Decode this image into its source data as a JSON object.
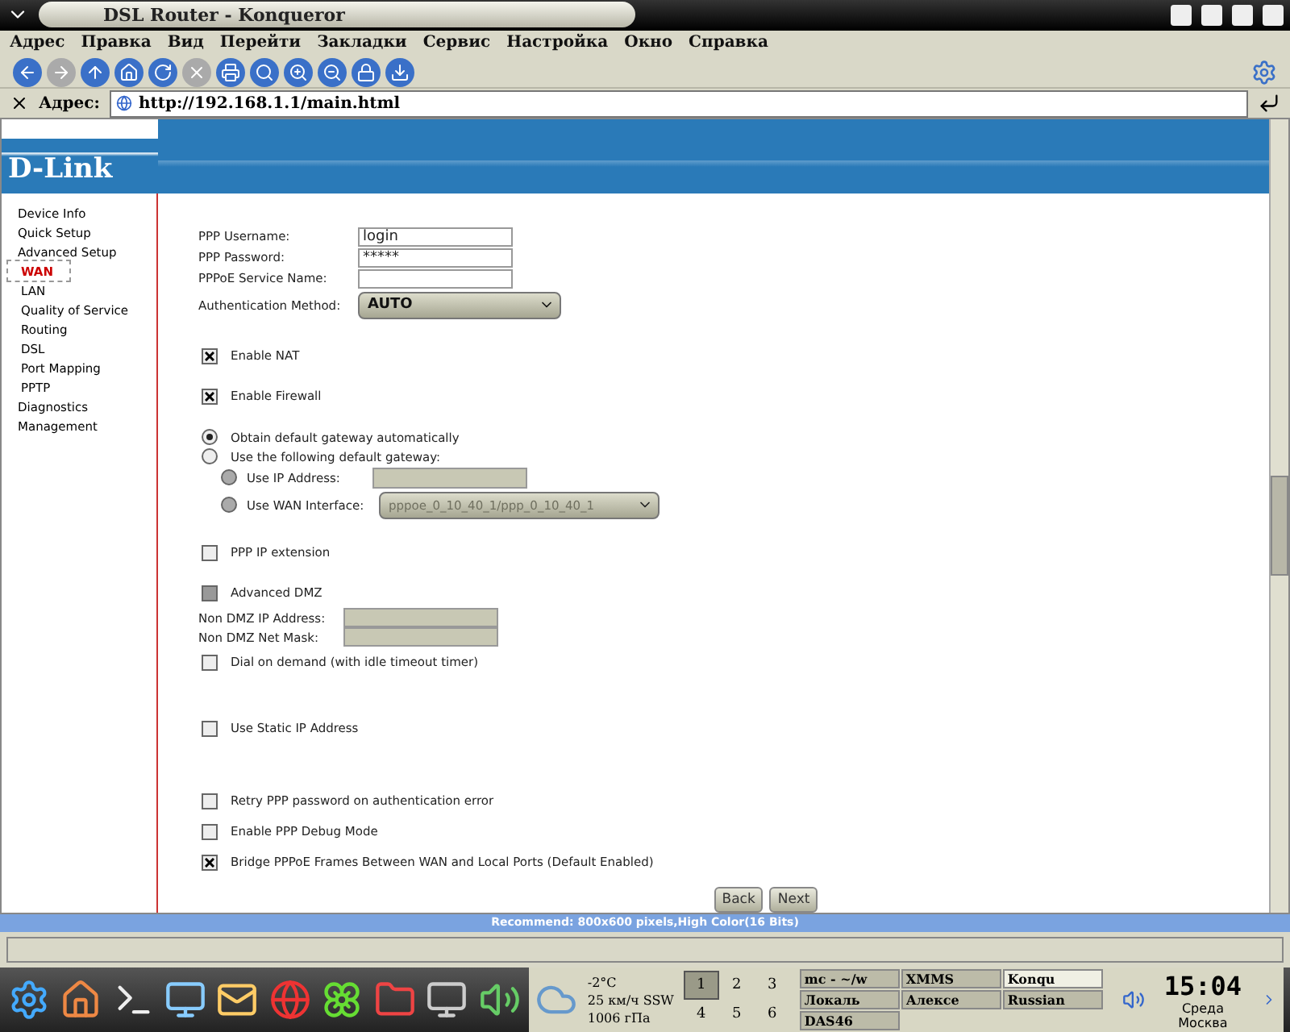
{
  "window": {
    "title": "DSL Router - Konqueror"
  },
  "menu": [
    "Адрес",
    "Правка",
    "Вид",
    "Перейти",
    "Закладки",
    "Сервис",
    "Настройка",
    "Окно",
    "Справка"
  ],
  "toolbar": [
    {
      "kind": "back",
      "disabled": false
    },
    {
      "kind": "forward",
      "disabled": true
    },
    {
      "kind": "up",
      "disabled": false
    },
    {
      "kind": "home",
      "disabled": false
    },
    {
      "kind": "reload",
      "disabled": false
    },
    {
      "kind": "stop",
      "disabled": true
    },
    {
      "kind": "print",
      "disabled": false
    },
    {
      "kind": "find",
      "disabled": false
    },
    {
      "kind": "zoomin",
      "disabled": false
    },
    {
      "kind": "zoomout",
      "disabled": false
    },
    {
      "kind": "lock",
      "disabled": false
    },
    {
      "kind": "download",
      "disabled": false
    }
  ],
  "address": {
    "label": "Адрес:",
    "value": "http://192.168.1.1/main.html"
  },
  "logo": "D-Link",
  "sidebar": [
    {
      "label": "Device Info",
      "selected": false
    },
    {
      "label": "Quick Setup",
      "selected": false
    },
    {
      "label": "Advanced Setup",
      "selected": false,
      "children": [
        {
          "label": "WAN",
          "selected": true
        },
        {
          "label": "LAN",
          "selected": false
        },
        {
          "label": "Quality of Service",
          "selected": false
        },
        {
          "label": "Routing",
          "selected": false
        },
        {
          "label": "DSL",
          "selected": false
        },
        {
          "label": "Port Mapping",
          "selected": false
        },
        {
          "label": "PPTP",
          "selected": false
        }
      ]
    },
    {
      "label": "Diagnostics",
      "selected": false
    },
    {
      "label": "Management",
      "selected": false
    }
  ],
  "sections": [
    [
      {
        "kind": "field",
        "label": "PPP Username:",
        "value": "login"
      },
      {
        "kind": "field",
        "label": "PPP Password:",
        "value": "*****"
      },
      {
        "kind": "field",
        "label": "PPPoE Service Name:"
      },
      {
        "kind": "select",
        "label": "Authentication Method:",
        "value": "AUTO",
        "disabled": false
      }
    ],
    [
      {
        "kind": "checkbox",
        "label": "Enable NAT",
        "checked": true,
        "disabled": false
      }
    ],
    [
      {
        "kind": "checkbox",
        "label": "Enable Firewall",
        "checked": true,
        "disabled": false
      }
    ],
    [
      {
        "kind": "radio",
        "label": "Obtain default gateway automatically",
        "selected": true,
        "disabled": false
      },
      {
        "kind": "radio",
        "label": "Use the following default gateway:",
        "selected": false,
        "disabled": false
      },
      {
        "kind": "subradio_field",
        "label": "Use IP Address:",
        "selected": false,
        "disabled": true
      },
      {
        "kind": "subradio_select",
        "label": "Use WAN Interface:",
        "value": "pppoe_0_10_40_1/ppp_0_10_40_1",
        "selected": false,
        "disabled": true
      }
    ],
    [
      {
        "kind": "checkbox",
        "label": "PPP IP extension",
        "checked": false,
        "disabled": false
      }
    ],
    [
      {
        "kind": "checkbox",
        "label": "Advanced DMZ",
        "checked": false,
        "disabled": true
      },
      {
        "kind": "dmzfield",
        "label": "Non DMZ IP Address:"
      },
      {
        "kind": "dmzfield",
        "label": "Non DMZ Net Mask:"
      },
      {
        "kind": "checkbox",
        "label": "Dial on demand (with idle timeout timer)",
        "checked": false,
        "disabled": false
      }
    ],
    [
      {
        "kind": "checkbox",
        "label": "Use Static IP Address",
        "checked": false,
        "disabled": false
      }
    ],
    [
      {
        "kind": "checkbox",
        "label": "Retry PPP password on authentication error",
        "checked": false,
        "disabled": false
      },
      {
        "kind": "checkbox",
        "label": "Enable PPP Debug Mode",
        "checked": false,
        "disabled": false
      },
      {
        "kind": "checkbox",
        "label": "Bridge PPPoE Frames Between WAN and Local Ports (Default Enabled)",
        "checked": true,
        "disabled": false
      }
    ]
  ],
  "buttons": [
    "Back",
    "Next"
  ],
  "footer": "Recommend: 800x600 pixels,High Color(16 Bits)",
  "taskbar": {
    "weather": [
      "-2°C",
      "25 км/ч SSW",
      "1006 гПа"
    ],
    "desktops": [
      {
        "label": "1",
        "selected": true
      },
      {
        "label": "2",
        "selected": false
      },
      {
        "label": "3",
        "selected": false
      },
      {
        "label": "4",
        "selected": false
      },
      {
        "label": "5",
        "selected": false
      },
      {
        "label": "6",
        "selected": false
      }
    ],
    "tasks": [
      {
        "label": "mc - ~/w",
        "selected": false
      },
      {
        "label": "XMMS",
        "selected": false
      },
      {
        "label": "Konqu",
        "selected": true
      },
      {
        "label": "Локаль",
        "selected": false
      },
      {
        "label": "Алексе",
        "selected": false
      },
      {
        "label": "Russian",
        "selected": false
      },
      {
        "label": "DAS46",
        "selected": false
      }
    ],
    "clock": {
      "time": "15:04",
      "day": "Среда",
      "place": "Москва"
    }
  }
}
